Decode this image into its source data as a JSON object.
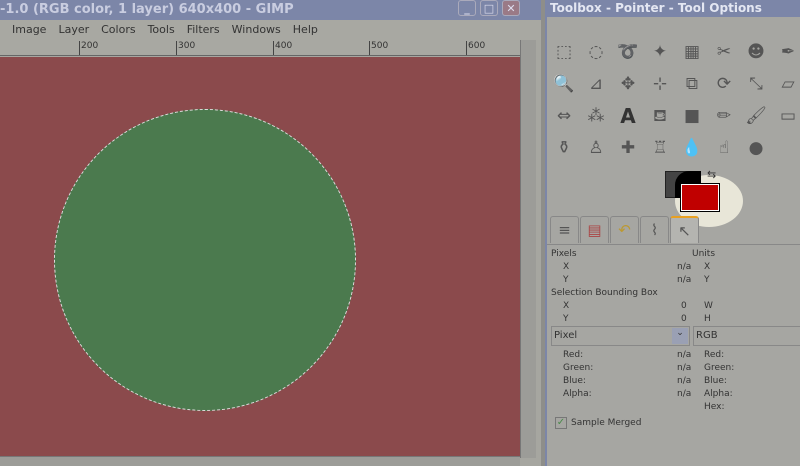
{
  "image_window": {
    "title": "-1.0 (RGB color, 1 layer) 640x400 - GIMP",
    "menu": [
      "Image",
      "Layer",
      "Colors",
      "Tools",
      "Filters",
      "Windows",
      "Help"
    ],
    "ruler_labels": [
      "200",
      "300",
      "400",
      "500",
      "600"
    ]
  },
  "toolbox": {
    "title": "Toolbox - Pointer - Tool Options",
    "tools": [
      "rect-select",
      "ellipse-select",
      "free-select",
      "fuzzy-select",
      "color-select",
      "scissors-select",
      "foreground-select",
      "paths",
      "zoom",
      "measure",
      "move",
      "align",
      "crop",
      "rotate",
      "scale",
      "shear",
      "flip",
      "cage",
      "text",
      "bucket-fill",
      "blend",
      "pencil",
      "paintbrush",
      "eraser",
      "ink",
      "clone",
      "heal",
      "perspective-clone",
      "blur",
      "smudge",
      "dodge-burn"
    ],
    "colors": {
      "foreground": "#000000",
      "background": "#c00000"
    },
    "tabs": [
      "layers",
      "channels",
      "undo",
      "paths",
      "pointer"
    ]
  },
  "pointer": {
    "pixels_label": "Pixels",
    "units_label": "Units",
    "pixels": [
      {
        "k": "X",
        "v": "n/a",
        "u": "X"
      },
      {
        "k": "Y",
        "v": "n/a",
        "u": "Y"
      }
    ],
    "bbox_label": "Selection Bounding Box",
    "bbox": [
      {
        "k": "X",
        "v": "0",
        "u": "W"
      },
      {
        "k": "Y",
        "v": "0",
        "u": "H"
      }
    ],
    "mode_left": "Pixel",
    "mode_right": "RGB",
    "channels": [
      {
        "k": "Red:",
        "v": "n/a",
        "r": "Red:"
      },
      {
        "k": "Green:",
        "v": "n/a",
        "r": "Green:"
      },
      {
        "k": "Blue:",
        "v": "n/a",
        "r": "Blue:"
      },
      {
        "k": "Alpha:",
        "v": "n/a",
        "r": "Alpha:"
      }
    ],
    "hex_label": "Hex:",
    "sample_merged": "Sample Merged",
    "sample_merged_checked": true
  }
}
